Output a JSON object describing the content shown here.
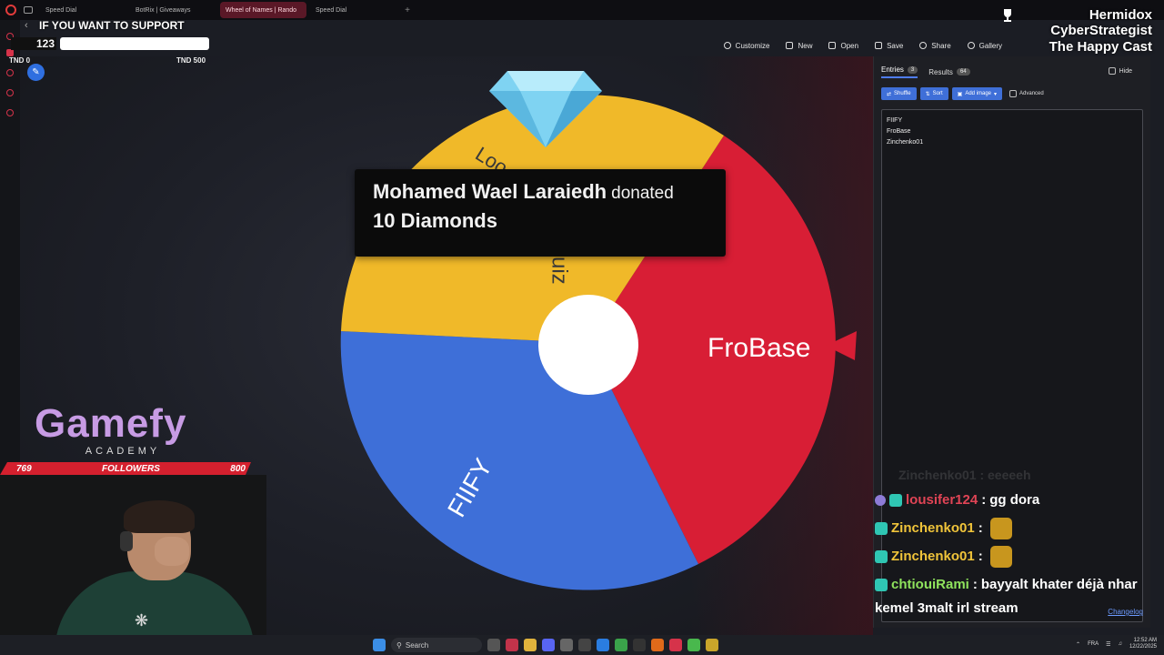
{
  "browser": {
    "tabs": [
      {
        "label": "Speed Dial",
        "active": false
      },
      {
        "label": "BotRix | Giveaways",
        "active": false
      },
      {
        "label": "Wheel of Names | Rando",
        "active": true
      },
      {
        "label": "Speed Dial",
        "active": false
      }
    ],
    "new_tab": "+"
  },
  "overlay": {
    "support_title": "IF YOU WANT TO SUPPORT",
    "counter_value": "123",
    "goal_start": "TND 0",
    "goal_end": "TND 500",
    "streamer_names": [
      "Hermidox",
      "CyberStrategist",
      "The Happy Cast"
    ]
  },
  "header": {
    "buttons": [
      "Customize",
      "New",
      "Open",
      "Save",
      "Share",
      "Gallery"
    ]
  },
  "wheel": {
    "segments": [
      {
        "label": "FroBase",
        "color": "#d81e35"
      },
      {
        "label": "FIIFY",
        "color": "#3e6fd8"
      },
      {
        "label": "Zinchenko01",
        "color": "#f0b929"
      }
    ],
    "visible_labels": {
      "frobase": "FroBase",
      "fiify": "FIIFY",
      "quiz": "Quiz",
      "loo": "Loo"
    },
    "hub_color": "#ffffff",
    "pointer_color": "#d81e35"
  },
  "donation": {
    "name": "Mohamed Wael Laraiedh",
    "verb": "donated",
    "amount": "10 Diamonds"
  },
  "brand": {
    "name": "Gamefy",
    "sub": "ACADEMY",
    "color": "#c79be4"
  },
  "followers": {
    "current": "769",
    "label": "FOLLOWERS",
    "goal": "800"
  },
  "panel": {
    "tab_entries": "Entries",
    "entries_count": "3",
    "tab_results": "Results",
    "results_count": "64",
    "hide_label": "Hide",
    "tools": [
      "Shuffle",
      "Sort",
      "Add image"
    ],
    "advanced_label": "Advanced",
    "entries": [
      "FIIFY",
      "FroBase",
      "Zinchenko01"
    ],
    "changelog": "Changelog"
  },
  "chat": {
    "faded": "Zinchenko01 : eeeeeh",
    "lines": [
      {
        "user": "lousifer124",
        "msg": "gg dora",
        "color": "red"
      },
      {
        "user": "Zinchenko01",
        "msg": "",
        "color": "gold"
      },
      {
        "user": "Zinchenko01",
        "msg": "",
        "color": "gold"
      },
      {
        "user": "chtiouiRami",
        "msg": "bayyalt khater déjà nhar",
        "color": "green"
      }
    ],
    "tail": "kemel 3malt irl stream"
  },
  "taskbar": {
    "search": "Search",
    "lang": "FRA",
    "time": "12:52 AM",
    "date": "12/22/2025"
  }
}
